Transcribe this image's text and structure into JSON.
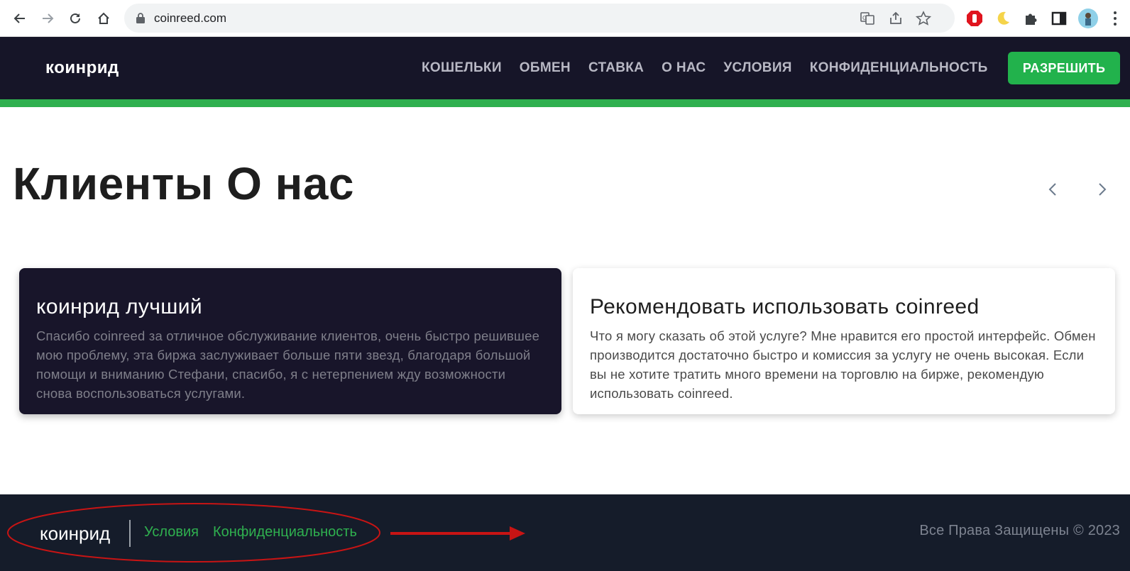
{
  "browser": {
    "url": "coinreed.com"
  },
  "site": {
    "logo": "коинрид",
    "nav": [
      "КОШЕЛЬКИ",
      "ОБМЕН",
      "СТАВКА",
      "О НАС",
      "УСЛОВИЯ",
      "КОНФИДЕНЦИАЛЬНОСТЬ"
    ],
    "allow_button": "РАЗРЕШИТЬ",
    "accent_color": "#2fb04f",
    "header_color": "#161528"
  },
  "main": {
    "title": "Клиенты О нас",
    "testimonials": [
      {
        "heading": "коинрид лучший",
        "text": "Спасибо coinreed за отличное обслуживание клиентов, очень быстро решившее мою проблему, эта биржа заслуживает больше пяти звезд, благодаря большой помощи и вниманию Стефани, спасибо, я с нетерпением жду возможности снова воспользоваться услугами."
      },
      {
        "heading": "Рекомендовать использовать coinreed",
        "text": "Что я могу сказать об этой услуге? Мне нравится его простой интерфейс. Обмен производится достаточно быстро и комиссия за услугу не очень высокая. Если вы не хотите тратить много времени на торговлю на бирже, рекомендую использовать coinreed."
      }
    ]
  },
  "footer": {
    "logo": "коинрид",
    "links": [
      "Условия",
      "Конфиденциальность"
    ],
    "copyright": "Все Права Защищены © 2023",
    "annotation_color": "#c81414"
  }
}
